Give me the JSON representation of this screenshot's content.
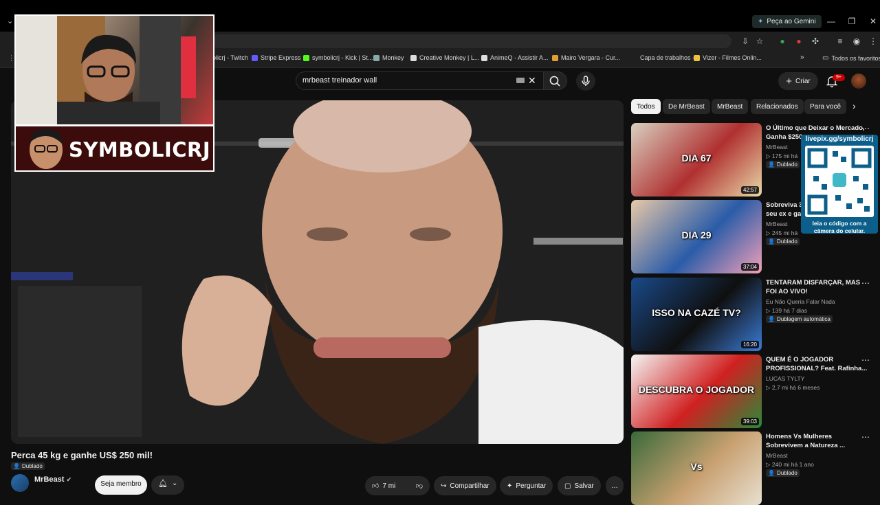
{
  "browser": {
    "gemini_label": "Peça ao Gemini",
    "bookmarks": [
      {
        "label": "olicrj - Twitch",
        "color": "#9146ff"
      },
      {
        "label": "Stripe Express",
        "color": "#635bff"
      },
      {
        "label": "symbolicrj - Kick | St...",
        "color": "#53fc18"
      },
      {
        "label": "Monkey",
        "color": "#8aa"
      },
      {
        "label": "Creative Monkey | L...",
        "color": "#ddd"
      },
      {
        "label": "AnimeQ - Assistir A...",
        "color": "#ddd"
      },
      {
        "label": "Mairo Vergara - Cur...",
        "color": "#e0a030"
      },
      {
        "label": "Capa de trabalhos -...",
        "color": "#1f1f1f"
      },
      {
        "label": "Vizer - Filmes Onlin...",
        "color": "#f0c040"
      }
    ],
    "all_bookmarks_label": "Todos os favoritos"
  },
  "youtube": {
    "search_query": "mrbeast treinador wall",
    "create_label": "Criar",
    "notif_badge": "9+"
  },
  "overlay": {
    "streamer_name": "SYMBOLICRJ",
    "qr_header": "livepix.gg/symbolicrj",
    "qr_footer_1": "leia o código com a",
    "qr_footer_2": "câmera do celular."
  },
  "video": {
    "title": "Perca 45 kg e ganhe US$ 250 mil!",
    "dub_badge": "Dublado",
    "channel": "MrBeast",
    "member_label": "Seja membro",
    "likes": "7 mi",
    "share_label": "Compartilhar",
    "ask_label": "Perguntar",
    "save_label": "Salvar"
  },
  "chips": [
    "Todos",
    "De MrBeast",
    "MrBeast",
    "Relacionados",
    "Para você"
  ],
  "recommendations": [
    {
      "title_1": "O Último que Deixar o Mercado,",
      "title_2": "Ganha $250",
      "channel": "MrBeast",
      "stats": "175 mi  há",
      "badge": "Dublado",
      "duration": "42:57",
      "thumb_text": "DIA 67",
      "colors": [
        "#d8d0c0",
        "#b03030",
        "#e8d8a8"
      ]
    },
    {
      "title_1": "Sobreviva 3",
      "title_2": "seu ex e gar",
      "channel": "MrBeast",
      "stats": "245 mi  há",
      "badge": "Dublado",
      "duration": "37:04",
      "thumb_text": "DIA 29",
      "colors": [
        "#e8c8a8",
        "#2a5ca8",
        "#f2a0b8"
      ]
    },
    {
      "title_1": "TENTARAM DISFARÇAR, MAS",
      "title_2": "FOI AO VIVO!",
      "channel": "Eu Não Queria Falar Nada",
      "stats": "139  há 7 dias",
      "badge": "Dublagem automática",
      "duration": "16:20",
      "thumb_text": "ISSO NA CAZÉ TV?",
      "colors": [
        "#1a4a8a",
        "#0f0f0f",
        "#3b7bd6"
      ]
    },
    {
      "title_1": "QUEM É O JOGADOR",
      "title_2": "PROFISSIONAL? Feat. Rafinha...",
      "channel": "LUCAS TYLTY",
      "stats": "2,7 mi  há 6 meses",
      "badge": "",
      "duration": "39:03",
      "thumb_text": "DESCUBRA O JOGADOR",
      "colors": [
        "#f5f5f5",
        "#d02020",
        "#2a8a3a"
      ]
    },
    {
      "title_1": "Homens Vs Mulheres",
      "title_2": "Sobrevivem a Natureza ...",
      "channel": "MrBeast",
      "stats": "240 mi  há 1 ano",
      "badge": "Dublado",
      "duration": "",
      "thumb_text": "Vs",
      "colors": [
        "#3a6a3a",
        "#c8a070",
        "#e8e0d0"
      ]
    }
  ]
}
